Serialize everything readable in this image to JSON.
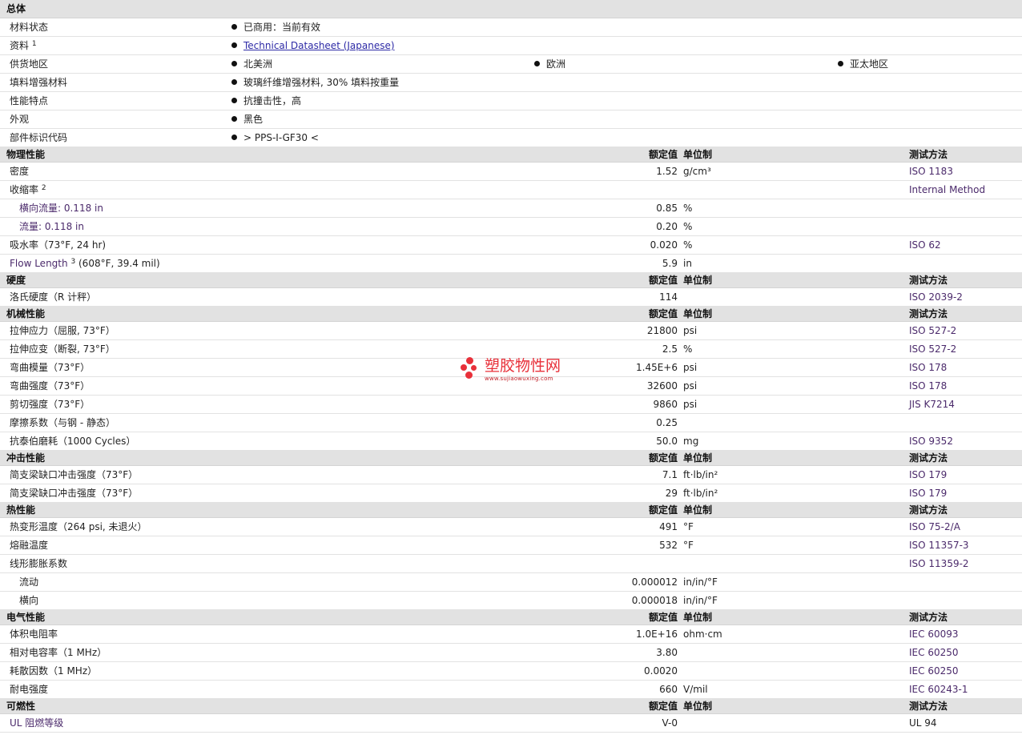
{
  "colors": {
    "section_bg": "#e2e2e2",
    "link": "#2d2aa6",
    "watermark": "#e8303a",
    "purple_text": "#4b2a6b"
  },
  "general": {
    "header": "总体",
    "status": {
      "label": "材料状态",
      "value": "已商用：当前有效"
    },
    "docs": {
      "label": "资料",
      "sup": "1",
      "value": "Technical Datasheet (Japanese)"
    },
    "supply": {
      "label": "供货地区",
      "values": [
        "北美洲",
        "欧洲",
        "亚太地区"
      ]
    },
    "filler": {
      "label": "填料增强材料",
      "value": "玻璃纤维增强材料, 30% 填料按重量"
    },
    "features": {
      "label": "性能特点",
      "value": "抗撞击性，高"
    },
    "appearance": {
      "label": "外观",
      "value": "黑色"
    },
    "part_code": {
      "label": "部件标识代码",
      "value": "> PPS-I-GF30 <"
    }
  },
  "columns": {
    "value": "额定值",
    "unit": "单位制",
    "test": "测试方法"
  },
  "physical": {
    "header": "物理性能",
    "rows": [
      {
        "name": "密度",
        "value": "1.52",
        "unit": "g/cm³",
        "test": "ISO 1183"
      },
      {
        "name": "收缩率",
        "sup": "2",
        "value": "",
        "unit": "",
        "test": "Internal Method"
      },
      {
        "name": "横向流量: 0.118 in",
        "value": "0.85",
        "unit": "%",
        "test": ""
      },
      {
        "name": "流量: 0.118 in",
        "value": "0.20",
        "unit": "%",
        "test": ""
      },
      {
        "name": "吸水率（73°F, 24 hr)",
        "value": "0.020",
        "unit": "%",
        "test": "ISO 62"
      },
      {
        "name": "Flow Length",
        "sup": "3",
        "name_suffix": "(608°F, 39.4 mil)",
        "value": "5.9",
        "unit": "in",
        "test": ""
      }
    ]
  },
  "hardness": {
    "header": "硬度",
    "rows": [
      {
        "name": "洛氏硬度（R 计秤）",
        "value": "114",
        "unit": "",
        "test": "ISO 2039-2"
      }
    ]
  },
  "mechanical": {
    "header": "机械性能",
    "rows": [
      {
        "name": "拉伸应力（屈服, 73°F）",
        "value": "21800",
        "unit": "psi",
        "test": "ISO 527-2"
      },
      {
        "name": "拉伸应变（断裂, 73°F）",
        "value": "2.5",
        "unit": "%",
        "test": "ISO 527-2"
      },
      {
        "name": "弯曲模量（73°F）",
        "value": "1.45E+6",
        "unit": "psi",
        "test": "ISO 178"
      },
      {
        "name": "弯曲强度（73°F）",
        "value": "32600",
        "unit": "psi",
        "test": "ISO 178"
      },
      {
        "name": "剪切强度（73°F）",
        "value": "9860",
        "unit": "psi",
        "test": "JIS K7214"
      },
      {
        "name": "摩擦系数（与钢 - 静态）",
        "value": "0.25",
        "unit": "",
        "test": ""
      },
      {
        "name": "抗泰伯磨耗（1000 Cycles）",
        "value": "50.0",
        "unit": "mg",
        "test": "ISO 9352"
      }
    ]
  },
  "impact": {
    "header": "冲击性能",
    "rows": [
      {
        "name": "简支梁缺口冲击强度（73°F）",
        "value": "7.1",
        "unit": "ft·lb/in²",
        "test": "ISO 179"
      },
      {
        "name": "简支梁缺口冲击强度（73°F）",
        "value": "29",
        "unit": "ft·lb/in²",
        "test": "ISO 179"
      }
    ]
  },
  "thermal": {
    "header": "热性能",
    "rows": [
      {
        "name": "热变形温度（264 psi, 未退火）",
        "value": "491",
        "unit": "°F",
        "test": "ISO 75-2/A"
      },
      {
        "name": "熔融温度",
        "value": "532",
        "unit": "°F",
        "test": "ISO 11357-3"
      },
      {
        "name": "线形膨胀系数",
        "value": "",
        "unit": "",
        "test": "ISO 11359-2"
      },
      {
        "name": "流动",
        "value": "0.000012",
        "unit": "in/in/°F",
        "test": ""
      },
      {
        "name": "横向",
        "value": "0.000018",
        "unit": "in/in/°F",
        "test": ""
      }
    ]
  },
  "electrical": {
    "header": "电气性能",
    "rows": [
      {
        "name": "体积电阻率",
        "value": "1.0E+16",
        "unit": "ohm·cm",
        "test": "IEC 60093"
      },
      {
        "name": "相对电容率（1 MHz）",
        "value": "3.80",
        "unit": "",
        "test": "IEC 60250"
      },
      {
        "name": "耗散因数（1 MHz）",
        "value": "0.0020",
        "unit": "",
        "test": "IEC 60250"
      },
      {
        "name": "耐电强度",
        "value": "660",
        "unit": "V/mil",
        "test": "IEC 60243-1"
      }
    ]
  },
  "flammability": {
    "header": "可燃性",
    "rows": [
      {
        "name": "UL 阻燃等级",
        "value": "V-0",
        "unit": "",
        "test": "UL 94"
      }
    ]
  },
  "watermark": {
    "title": "塑胶物性网",
    "url": "www.sujiaowuxing.com",
    "icon": "dots-logo-icon"
  }
}
